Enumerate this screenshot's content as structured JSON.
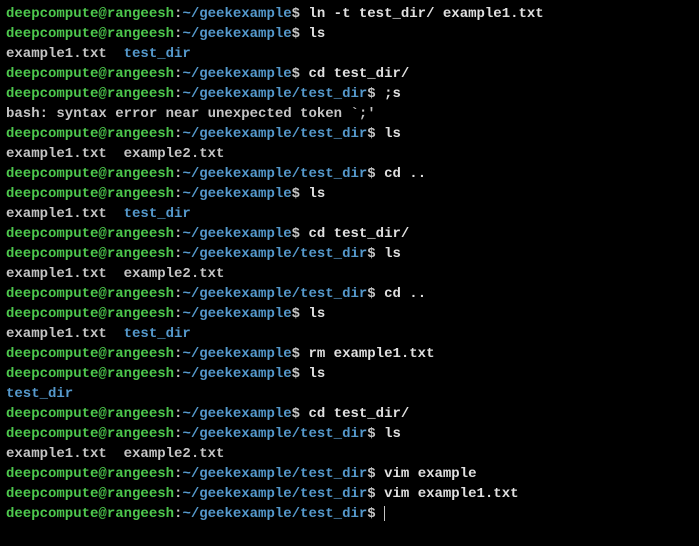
{
  "user": "deepcompute@rangeesh",
  "path1": "~/geekexample",
  "path2": "~/geekexample/test_dir",
  "dollar": "$",
  "colon": ":",
  "lines": {
    "l0_cmd": " ln -t test_dir/ example1.txt",
    "l1_cmd": " ls",
    "l2_out1": "example1.txt  ",
    "l2_dir": "test_dir",
    "l3_cmd": " cd test_dir/",
    "l4_cmd": " ;s",
    "l5_out": "bash: syntax error near unexpected token `;'",
    "l6_cmd": " ls",
    "l7_out": "example1.txt  example2.txt",
    "l8_cmd": " cd ..",
    "l9_cmd": " ls",
    "l10_out1": "example1.txt  ",
    "l10_dir": "test_dir",
    "l11_cmd": " cd test_dir/",
    "l12_cmd": " ls",
    "l13_out": "example1.txt  example2.txt",
    "l14_cmd": " cd ..",
    "l15_cmd": " ls",
    "l16_out1": "example1.txt  ",
    "l16_dir": "test_dir",
    "l17_cmd": " rm example1.txt",
    "l18_cmd": " ls",
    "l19_dir": "test_dir",
    "l20_cmd": " cd test_dir/",
    "l21_cmd": " ls",
    "l22_out": "example1.txt  example2.txt",
    "l23_cmd": " vim example",
    "l24_cmd": " vim example1.txt",
    "l25_cmd": " "
  }
}
